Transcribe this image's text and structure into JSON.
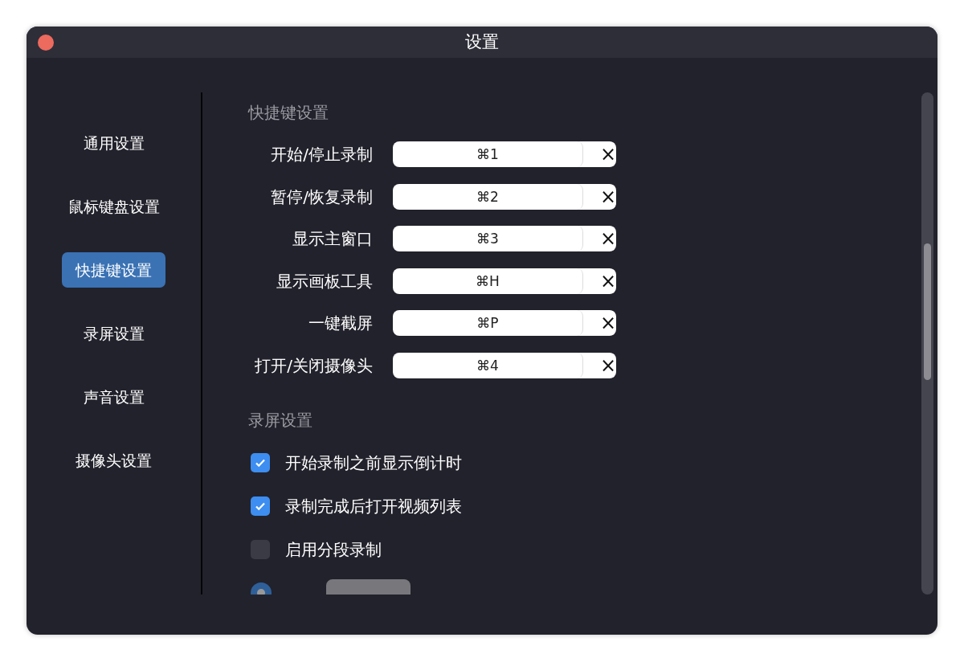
{
  "window": {
    "title": "设置"
  },
  "sidebar": {
    "items": [
      {
        "label": "通用设置",
        "selected": false
      },
      {
        "label": "鼠标键盘设置",
        "selected": false
      },
      {
        "label": "快捷键设置",
        "selected": true
      },
      {
        "label": "录屏设置",
        "selected": false
      },
      {
        "label": "声音设置",
        "selected": false
      },
      {
        "label": "摄像头设置",
        "selected": false
      }
    ]
  },
  "shortcuts": {
    "heading": "快捷键设置",
    "items": [
      {
        "label": "开始/停止录制",
        "value": "⌘1",
        "clear": "×"
      },
      {
        "label": "暂停/恢复录制",
        "value": "⌘2",
        "clear": "×"
      },
      {
        "label": "显示主窗口",
        "value": "⌘3",
        "clear": "×"
      },
      {
        "label": "显示画板工具",
        "value": "⌘H",
        "clear": "×"
      },
      {
        "label": "一键截屏",
        "value": "⌘P",
        "clear": "×"
      },
      {
        "label": "打开/关闭摄像头",
        "value": "⌘4",
        "clear": "×"
      }
    ]
  },
  "recording": {
    "heading": "录屏设置",
    "options": [
      {
        "label": "开始录制之前显示倒计时",
        "checked": true
      },
      {
        "label": "录制完成后打开视频列表",
        "checked": true
      },
      {
        "label": "启用分段录制",
        "checked": false
      }
    ],
    "segment": {
      "selected": true,
      "disabled": true
    }
  },
  "scrollbar": {
    "level": 0.3
  }
}
